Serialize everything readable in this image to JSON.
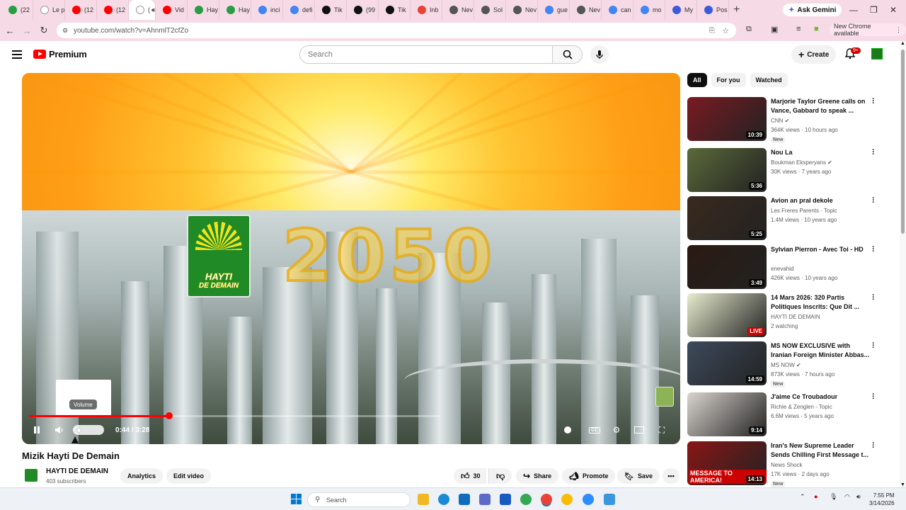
{
  "browser": {
    "tabs": [
      {
        "label": "(22",
        "color": "#2a9d44"
      },
      {
        "label": "Le p",
        "color": "#ffffff"
      },
      {
        "label": "(12",
        "color": "#ff0000"
      },
      {
        "label": "(12",
        "color": "#ff0000"
      },
      {
        "label": "(",
        "color": "#ffffff"
      },
      {
        "label": "Vid",
        "color": "#ff0000"
      },
      {
        "label": "Hay",
        "color": "#2a9d44"
      },
      {
        "label": "Hay",
        "color": "#2a9d44"
      },
      {
        "label": "inci",
        "color": "#4285f4"
      },
      {
        "label": "defi",
        "color": "#4285f4"
      },
      {
        "label": "Tik",
        "color": "#111111"
      },
      {
        "label": "(99",
        "color": "#111111"
      },
      {
        "label": "Tik",
        "color": "#111111"
      },
      {
        "label": "Inb",
        "color": "#ea4335"
      },
      {
        "label": "Nev",
        "color": "#555555"
      },
      {
        "label": "Sol",
        "color": "#555555"
      },
      {
        "label": "Nev",
        "color": "#555555"
      },
      {
        "label": "gue",
        "color": "#4285f4"
      },
      {
        "label": "Nev",
        "color": "#555555"
      },
      {
        "label": "can",
        "color": "#4285f4"
      },
      {
        "label": "mo",
        "color": "#4285f4"
      },
      {
        "label": "My",
        "color": "#3b5bdb"
      },
      {
        "label": "Pos",
        "color": "#3b5bdb"
      }
    ],
    "new_tab": "+",
    "ask_gemini": "Ask Gemini",
    "url": "youtube.com/watch?v=AhnmlT2cfZo",
    "new_chrome": "New Chrome available"
  },
  "youtube": {
    "logo_text": "Premium",
    "search_placeholder": "Search",
    "create_label": "Create",
    "notif_count": "9+"
  },
  "video": {
    "title": "Mizik Hayti De Demain",
    "logo_line1": "HAYTI",
    "logo_line2": "DE DEMAIN",
    "overlay_text": "2050",
    "volume_tooltip": "Volume",
    "time": "0:44 / 3:28",
    "progress_fraction": 0.34
  },
  "channel": {
    "name": "HAYTI DE DEMAIN",
    "subscribers": "403 subscribers",
    "analytics_label": "Analytics",
    "edit_label": "Edit video"
  },
  "actions": {
    "likes": "30",
    "share": "Share",
    "promote": "Promote",
    "save": "Save"
  },
  "filters": [
    "All",
    "For you",
    "Watched"
  ],
  "recommendations": [
    {
      "title": "Marjorie Taylor Greene calls on Vance, Gabbard to speak ...",
      "channel": "CNN",
      "verified": true,
      "meta": "364K views · 10 hours ago",
      "badge": "New",
      "duration": "10:39",
      "thumb": "#7a1a22"
    },
    {
      "title": "Nou La",
      "channel": "Boukman Eksperyans",
      "verified": true,
      "meta": "30K views · 7 years ago",
      "badge": "",
      "duration": "5:36",
      "thumb": "#5b6a3a"
    },
    {
      "title": "Avion an pral dekole",
      "channel": "Les Freres Parents · Topic",
      "verified": false,
      "meta": "1.4M views · 10 years ago",
      "badge": "",
      "duration": "5:25",
      "thumb": "#3a2a1e"
    },
    {
      "title": "Sylvian Pierron - Avec Toi - HD",
      "channel": "enevahid",
      "verified": false,
      "meta": "426K views · 10 years ago",
      "badge": "",
      "duration": "3:49",
      "thumb": "#2a1a12"
    },
    {
      "title": "14 Mars 2026: 320 Partis Politiques Inscrits: Que Dit ...",
      "channel": "HAYTI DE DEMAIN",
      "verified": false,
      "meta": "2 watching",
      "badge": "",
      "duration": "LIVE",
      "thumb": "#e8eccf"
    },
    {
      "title": "MS NOW EXCLUSIVE with Iranian Foreign Minister Abbas...",
      "channel": "MS NOW",
      "verified": true,
      "meta": "873K views · 7 hours ago",
      "badge": "New",
      "duration": "14:59",
      "thumb": "#3d4a5c"
    },
    {
      "title": "J'aime Ce Troubadour",
      "channel": "Richie & Zenglen - Topic",
      "verified": false,
      "meta": "6.6M views · 5 years ago",
      "badge": "",
      "duration": "9:14",
      "thumb": "#d9d4cf"
    },
    {
      "title": "Iran's New Supreme Leader Sends Chilling First Message t...",
      "channel": "News Shock",
      "verified": false,
      "meta": "17K views · 2 days ago",
      "badge": "New",
      "duration": "14:13",
      "thumb": "#8a1616",
      "caption": "MESSAGE TO AMERICA!"
    }
  ],
  "taskbar": {
    "search_placeholder": "Search",
    "time": "7:55 PM",
    "date": "3/14/2026"
  }
}
